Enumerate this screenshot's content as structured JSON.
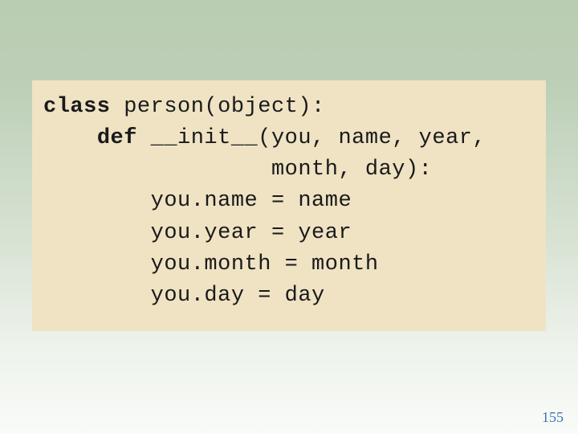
{
  "code": {
    "kw_class": "class",
    "line1_rest": " person(object):",
    "line2_indent": "    ",
    "kw_def": "def",
    "line2_rest": " __init__(you, name, year,",
    "line3": "                 month, day):",
    "line4": "        you.name = name",
    "line5": "        you.year = year",
    "line6": "        you.month = month",
    "line7": "        you.day = day"
  },
  "page_number": "155"
}
